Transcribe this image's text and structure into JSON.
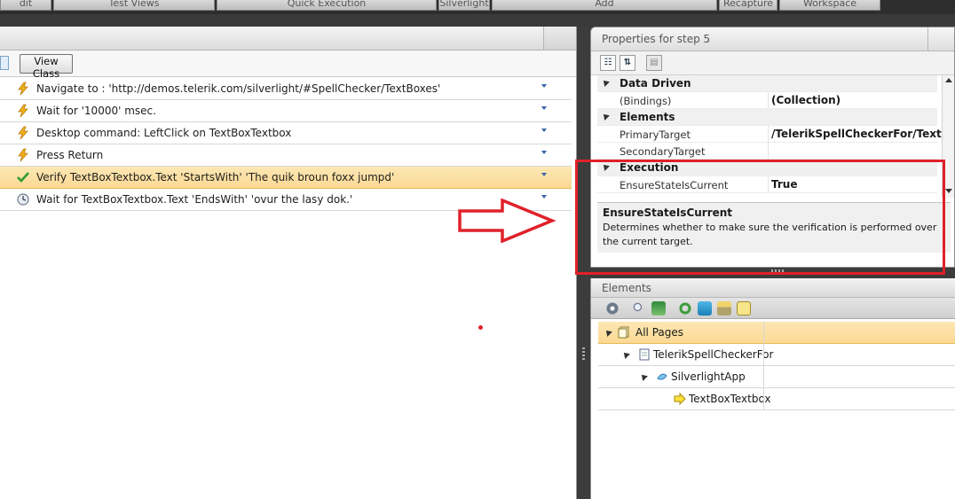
{
  "ribbon": {
    "tabs": [
      "dit",
      "Test Views",
      "Quick Execution",
      "Silverlight",
      "Add",
      "Recapture",
      "Workspace"
    ]
  },
  "left": {
    "view_class_label": "View Class",
    "steps": [
      {
        "text": "Navigate to : 'http://demos.telerik.com/silverlight/#SpellChecker/TextBoxes'",
        "icon": "lightning-icon",
        "selected": false
      },
      {
        "text": "Wait for '10000' msec.",
        "icon": "lightning-icon",
        "selected": false
      },
      {
        "text": "Desktop command: LeftClick on TextBoxTextbox",
        "icon": "lightning-icon",
        "selected": false
      },
      {
        "text": "Press Return",
        "icon": "lightning-icon",
        "selected": false
      },
      {
        "text": "Verify TextBoxTextbox.Text 'StartsWith' 'The quik broun foxx jumpd'",
        "icon": "checkmark-icon",
        "selected": true
      },
      {
        "text": "Wait for TextBoxTextbox.Text 'EndsWith' 'ovur the lasy dok.'",
        "icon": "clock-icon",
        "selected": false
      }
    ]
  },
  "properties": {
    "title": "Properties for step 5",
    "rows": [
      {
        "kind": "category",
        "name": "Data Driven"
      },
      {
        "kind": "property",
        "name": "(Bindings)",
        "value": "(Collection)"
      },
      {
        "kind": "category",
        "name": "Elements"
      },
      {
        "kind": "property",
        "name": "PrimaryTarget",
        "value": "/TelerikSpellCheckerFor/TextBoxT"
      },
      {
        "kind": "property",
        "name": "SecondaryTarget",
        "value": ""
      },
      {
        "kind": "category",
        "name": "Execution"
      },
      {
        "kind": "property",
        "name": "EnsureStateIsCurrent",
        "value": "True"
      }
    ],
    "description_title": "EnsureStateIsCurrent",
    "description_text": "Determines whether to make sure the verification is performed over the current target."
  },
  "elements": {
    "title": "Elements",
    "tree": [
      {
        "label": "All Pages",
        "icon": "pages-icon",
        "level": 0,
        "selected": true
      },
      {
        "label": "TelerikSpellCheckerFor",
        "icon": "page-icon",
        "level": 1,
        "selected": false
      },
      {
        "label": "SilverlightApp",
        "icon": "silverlight-icon",
        "level": 2,
        "selected": false
      },
      {
        "label": "TextBoxTextbox",
        "icon": "element-arrow-icon",
        "level": 3,
        "selected": false
      }
    ]
  },
  "colors": {
    "annotation_red": "#e0212a",
    "selection_orange": "#fbd994"
  }
}
